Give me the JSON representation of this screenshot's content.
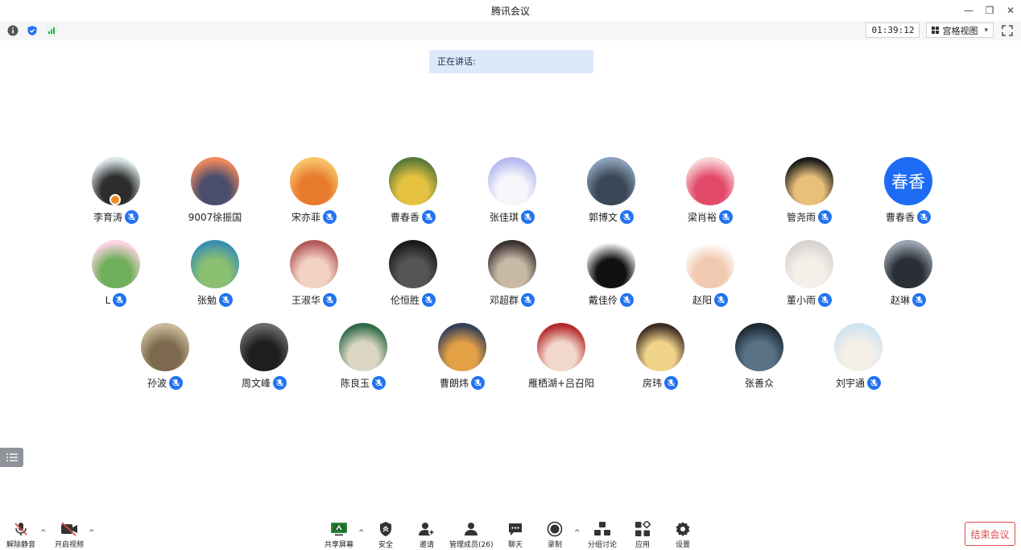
{
  "window": {
    "title": "腾讯会议",
    "minimize": "—",
    "restore": "❐",
    "close": "✕"
  },
  "infobar": {
    "icons": [
      "info-icon",
      "shield-icon",
      "signal-icon"
    ],
    "timer": "01:39:12",
    "view_label": "宫格视图",
    "view_caret": "▾"
  },
  "speaking_label": "正在讲话:",
  "participants": [
    {
      "name": "李育涛",
      "mic": true,
      "avatar_colors": [
        "#dbe6e8",
        "#2d2d2d"
      ],
      "host": true
    },
    {
      "name": "9007徐振国",
      "mic": false,
      "avatar_colors": [
        "#f08a5d",
        "#4a4e6d"
      ]
    },
    {
      "name": "宋亦菲",
      "mic": true,
      "avatar_colors": [
        "#f6c56a",
        "#e87a2c"
      ]
    },
    {
      "name": "曹春香",
      "mic": true,
      "avatar_colors": [
        "#5a7a3a",
        "#e5c240"
      ]
    },
    {
      "name": "张佳琪",
      "mic": true,
      "avatar_colors": [
        "#b5b9f0",
        "#f7f7fb"
      ]
    },
    {
      "name": "郭博文",
      "mic": true,
      "avatar_colors": [
        "#8aa0b8",
        "#3b4756"
      ]
    },
    {
      "name": "梁肖裕",
      "mic": true,
      "avatar_colors": [
        "#f9d5d8",
        "#e24a6a"
      ]
    },
    {
      "name": "管尧雨",
      "mic": true,
      "avatar_colors": [
        "#1a1a1a",
        "#e8c07a"
      ]
    },
    {
      "name": "曹春香",
      "mic": true,
      "avatar_text": "春香"
    },
    {
      "name": "L",
      "mic": true,
      "avatar_colors": [
        "#fbd4e1",
        "#6fae5a"
      ]
    },
    {
      "name": "张勉",
      "mic": true,
      "avatar_colors": [
        "#3a8fb0",
        "#8ac070"
      ]
    },
    {
      "name": "王淑华",
      "mic": true,
      "avatar_colors": [
        "#b35a5a",
        "#f3d2c4"
      ]
    },
    {
      "name": "伦恒胜",
      "mic": true,
      "avatar_colors": [
        "#1a1a1a",
        "#555555"
      ]
    },
    {
      "name": "邓超群",
      "mic": true,
      "avatar_colors": [
        "#3a3030",
        "#c8b9a5"
      ]
    },
    {
      "name": "戴佳伶",
      "mic": true,
      "avatar_colors": [
        "#ffffff",
        "#111111"
      ]
    },
    {
      "name": "赵阳",
      "mic": true,
      "avatar_colors": [
        "#ffffff",
        "#f1c8b0"
      ]
    },
    {
      "name": "董小雨",
      "mic": true,
      "avatar_colors": [
        "#d9d3cf",
        "#f5efe9"
      ]
    },
    {
      "name": "赵琳",
      "mic": true,
      "avatar_colors": [
        "#9aa4b0",
        "#2a2f36"
      ]
    },
    {
      "name": "孙波",
      "mic": true,
      "avatar_colors": [
        "#c9b99a",
        "#7d6a4e"
      ]
    },
    {
      "name": "周文峰",
      "mic": true,
      "avatar_colors": [
        "#6b6b6b",
        "#1e1e1e"
      ]
    },
    {
      "name": "陈良玉",
      "mic": true,
      "avatar_colors": [
        "#2f6b4a",
        "#dcd7c2"
      ]
    },
    {
      "name": "曹朗炜",
      "mic": true,
      "avatar_colors": [
        "#33405a",
        "#e3a044"
      ]
    },
    {
      "name": "雁栖湖+吕召阳",
      "mic": false,
      "avatar_colors": [
        "#b42a2a",
        "#f2d8cc"
      ]
    },
    {
      "name": "房玮",
      "mic": true,
      "avatar_colors": [
        "#3b2c22",
        "#f0d48a"
      ]
    },
    {
      "name": "张善众",
      "mic": false,
      "avatar_colors": [
        "#1c2a36",
        "#5a7286"
      ]
    },
    {
      "name": "刘宇通",
      "mic": true,
      "avatar_colors": [
        "#cfe3f0",
        "#f4efe7"
      ]
    }
  ],
  "toolbar": {
    "unmute": "解除静音",
    "start_video": "开启视频",
    "share_screen": "共享屏幕",
    "security": "安全",
    "invite": "邀请",
    "members": "管理成员(26)",
    "chat": "聊天",
    "record": "录制",
    "breakout": "分组讨论",
    "apps": "应用",
    "settings": "设置",
    "caret": "^",
    "end_meeting": "结束会议"
  }
}
